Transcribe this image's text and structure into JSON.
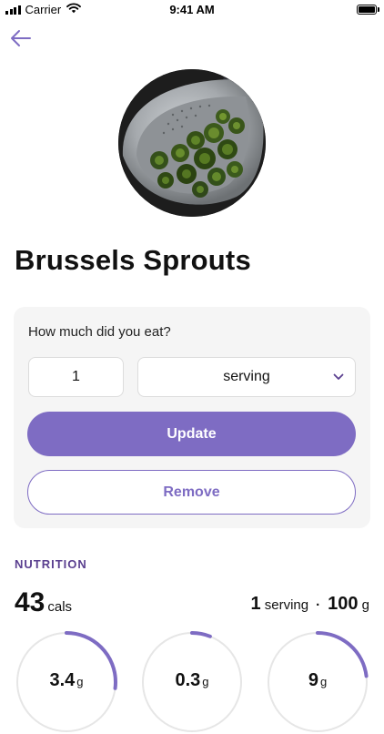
{
  "status_bar": {
    "carrier": "Carrier",
    "time": "9:41 AM"
  },
  "header": {
    "back_icon": "arrow-left-icon"
  },
  "food": {
    "name": "Brussels Sprouts"
  },
  "portion": {
    "question": "How much did you eat?",
    "quantity": "1",
    "unit": "serving",
    "update_label": "Update",
    "remove_label": "Remove"
  },
  "nutrition": {
    "heading": "NUTRITION",
    "calories": "43",
    "calories_unit": "cals",
    "serving_qty": "1",
    "serving_unit": "serving",
    "separator": "·",
    "weight": "100",
    "weight_unit": "g",
    "macros": [
      {
        "value": "3.4",
        "unit": "g",
        "fill": 0.27
      },
      {
        "value": "0.3",
        "unit": "g",
        "fill": 0.06
      },
      {
        "value": "9",
        "unit": "g",
        "fill": 0.23
      }
    ]
  },
  "colors": {
    "accent": "#7e6cc3",
    "heading": "#5a3f8f",
    "card_background": "#f5f5f5"
  }
}
